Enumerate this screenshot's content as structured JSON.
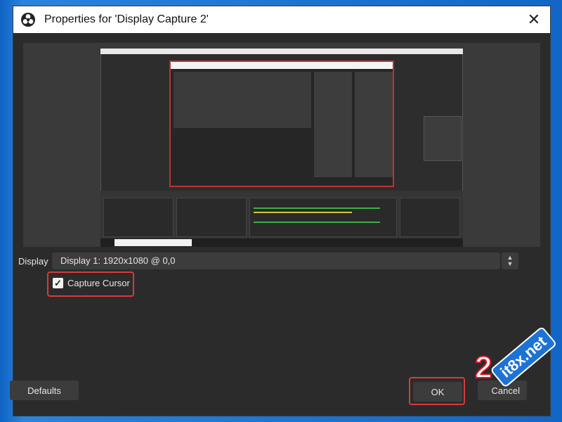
{
  "window": {
    "title": "Properties for 'Display Capture 2'",
    "close_glyph": "✕"
  },
  "preview": {
    "taskbar_search_placeholder": "Type here to search"
  },
  "display": {
    "label": "Display",
    "value": "Display 1: 1920x1080 @ 0,0"
  },
  "capture_cursor": {
    "label": "Capture Cursor",
    "checked": true,
    "check_glyph": "✓"
  },
  "buttons": {
    "defaults": "Defaults",
    "ok": "OK",
    "cancel": "Cancel"
  },
  "annotation": {
    "step": "2",
    "watermark": "it8x.net"
  },
  "colors": {
    "highlight": "#d63b3b",
    "window_bg": "#2b2b2b"
  }
}
